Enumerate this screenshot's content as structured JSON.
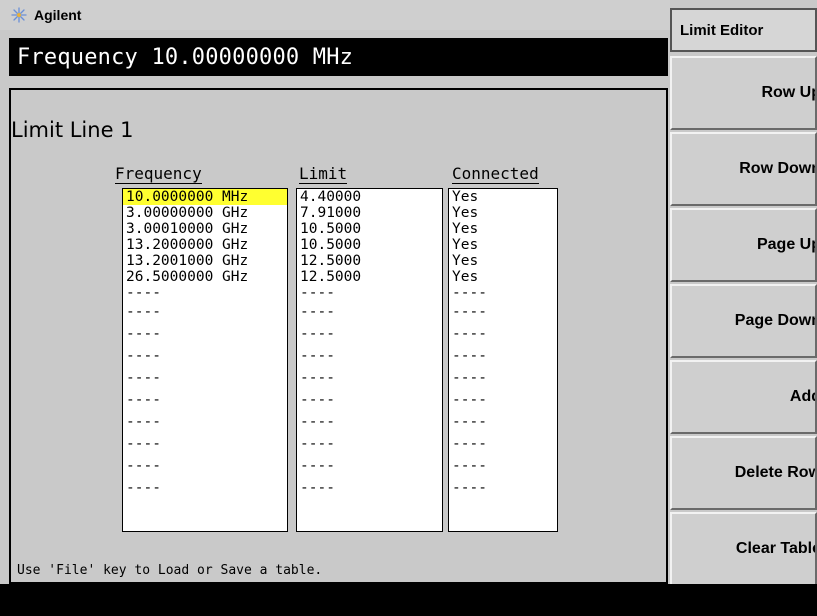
{
  "brand": {
    "name": "Agilent",
    "logo_icon": "agilent-spark-icon"
  },
  "frequency_display": "Frequency 10.00000000 MHz",
  "limit_editor": {
    "title": "Limit Line 1",
    "columns": {
      "frequency": "Frequency",
      "limit": "Limit",
      "connected": "Connected"
    },
    "rows": [
      {
        "frequency": "10.0000000 MHz",
        "limit": "4.40000",
        "connected": "Yes",
        "selected": true
      },
      {
        "frequency": "3.00000000 GHz",
        "limit": "7.91000",
        "connected": "Yes"
      },
      {
        "frequency": "3.00010000 GHz",
        "limit": "10.5000",
        "connected": "Yes"
      },
      {
        "frequency": "13.2000000 GHz",
        "limit": "10.5000",
        "connected": "Yes"
      },
      {
        "frequency": "13.2001000 GHz",
        "limit": "12.5000",
        "connected": "Yes"
      },
      {
        "frequency": "26.5000000 GHz",
        "limit": "12.5000",
        "connected": "Yes"
      }
    ],
    "empty_cell": "----",
    "empty_row_count": 10,
    "hint": "Use 'File' key to Load or Save a table."
  },
  "softkeys": {
    "title": "Limit Editor",
    "buttons": [
      {
        "label": "Row Up"
      },
      {
        "label": "Row Down"
      },
      {
        "label": "Page Up"
      },
      {
        "label": "Page Down"
      },
      {
        "label": "Add"
      },
      {
        "label": "Delete Row"
      },
      {
        "label": "Clear Table"
      }
    ]
  },
  "colors": {
    "selection_highlight": "#ffff30",
    "panel_background": "#c9c9c9",
    "header_bar": "#000000"
  }
}
